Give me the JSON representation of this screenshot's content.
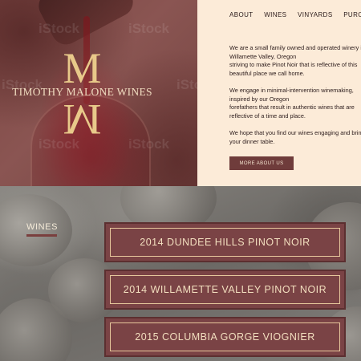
{
  "brand": {
    "monogram_top": "M",
    "monogram_bottom": "M",
    "name": "TIMOTHY MALONE WINES",
    "watermark": "iStock"
  },
  "nav": {
    "items": [
      "ABOUT",
      "WINES",
      "VINYARDS",
      "PURCHASE"
    ]
  },
  "about": {
    "paragraphs": [
      [
        "We are a small family owned and operated winery in the",
        "Willamette Valley, Oregon",
        "striving to make Pinot Noir that is reflective of this",
        "beautiful place we call home."
      ],
      [
        "We engage in minimal-intervention winemaking,",
        "inspired by our Oregon",
        "forefathers that result in authentic wines that are",
        "reflective of a time and place."
      ],
      [
        "We hope that you find our wines engaging and bring them to",
        "your dinner table."
      ]
    ],
    "button_label": "MORE ABOUT US"
  },
  "wines": {
    "heading": "WINES",
    "items": [
      "2014 DUNDEE HILLS PINOT NOIR",
      "2014 WILLAMETTE VALLEY PINOT NOIR",
      "2015 COLUMBIA GORGE VIOGNIER"
    ]
  },
  "colors": {
    "cream": "#fcebd8",
    "burgundy": "#7a4345",
    "gold": "#e8c98a"
  }
}
